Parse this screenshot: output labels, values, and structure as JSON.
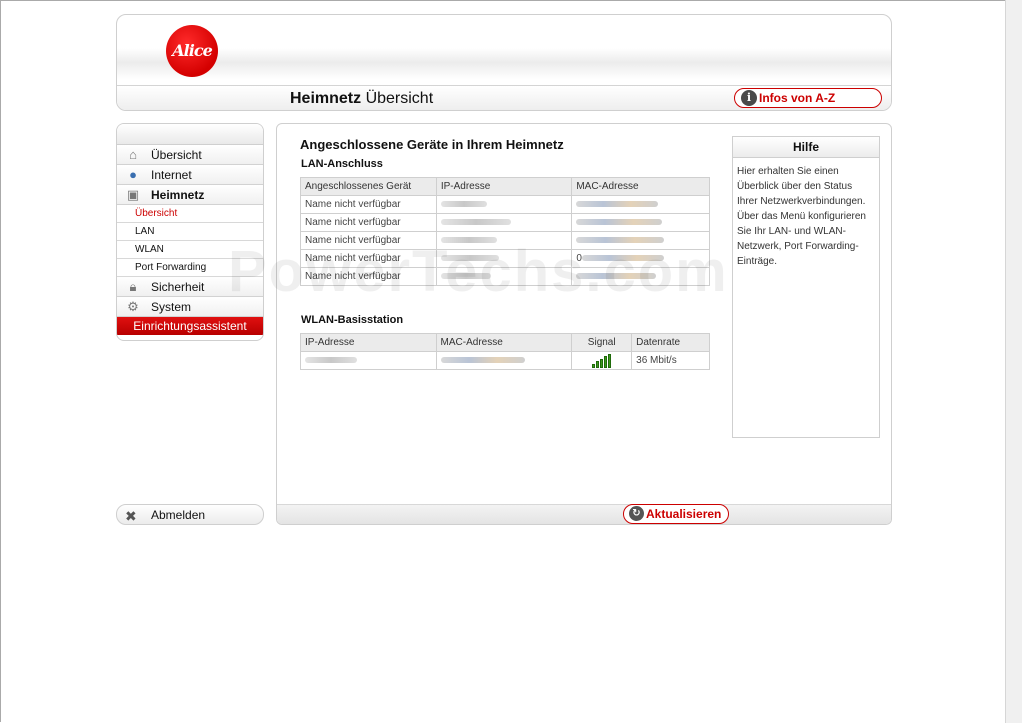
{
  "header": {
    "logo_text": "Alice",
    "title_bold": "Heimnetz",
    "title_rest": " Übersicht",
    "infos_button": "Infos von A-Z"
  },
  "sidebar": {
    "items": [
      {
        "label": "Übersicht",
        "icon": "home-icon"
      },
      {
        "label": "Internet",
        "icon": "globe-icon"
      },
      {
        "label": "Heimnetz",
        "icon": "network-icon"
      }
    ],
    "subitems": [
      "Übersicht",
      "LAN",
      "WLAN",
      "Port Forwarding"
    ],
    "items_after": [
      {
        "label": "Sicherheit",
        "icon": "lock-icon"
      },
      {
        "label": "System",
        "icon": "gear-icon"
      }
    ],
    "wizard": "Einrichtungsassistent",
    "logout": "Abmelden"
  },
  "main": {
    "heading": "Angeschlossene Geräte in Ihrem Heimnetz",
    "lan_title": "LAN-Anschluss",
    "lan_headers": [
      "Angeschlossenes Gerät",
      "IP-Adresse",
      "MAC-Adresse"
    ],
    "lan_rows": [
      {
        "device": "Name nicht verfügbar",
        "ip_mac_prefix": ""
      },
      {
        "device": "Name nicht verfügbar",
        "ip_mac_prefix": ""
      },
      {
        "device": "Name nicht verfügbar",
        "ip_mac_prefix": ""
      },
      {
        "device": "Name nicht verfügbar",
        "ip_mac_prefix": "0"
      },
      {
        "device": "Name nicht verfügbar",
        "ip_mac_prefix": ""
      }
    ],
    "wlan_title": "WLAN-Basisstation",
    "wlan_headers": [
      "IP-Adresse",
      "MAC-Adresse",
      "Signal",
      "Datenrate"
    ],
    "wlan_rows": [
      {
        "datarate": "36 Mbit/s",
        "signal_bars": 5,
        "signal_level": 5
      }
    ],
    "refresh_button": "Aktualisieren"
  },
  "help": {
    "title": "Hilfe",
    "text": "Hier erhalten Sie einen Überblick über den Status Ihrer Netzwerkverbindungen. Über das Menü konfigurieren Sie Ihr LAN- und WLAN-Netzwerk, Port Forwarding-Einträge."
  },
  "watermark": "PowerTechs.com",
  "colors": {
    "accent": "#cc0000",
    "signal": "#3c9a1c"
  }
}
